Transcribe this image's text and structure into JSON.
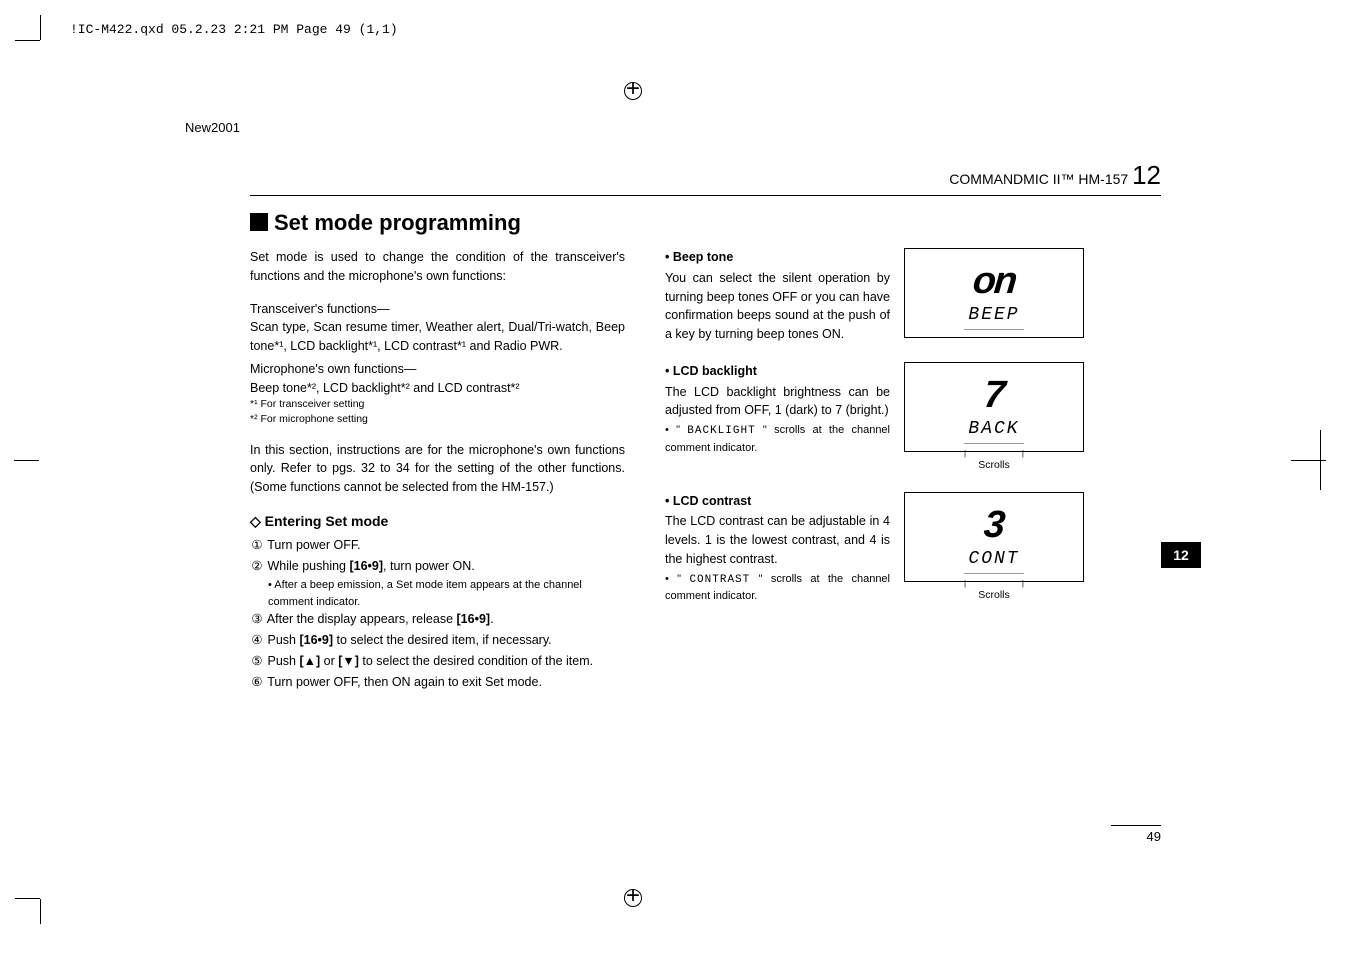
{
  "meta": {
    "header_line": "!IC-M422.qxd  05.2.23 2:21 PM  Page 49 (1,1)",
    "new_label": "New2001"
  },
  "page_header": {
    "product": "COMMANDMIC II™ HM-157",
    "chapter": "12"
  },
  "section": {
    "title": "Set mode programming"
  },
  "left": {
    "intro": "Set mode is used to change the condition of the transceiver's functions and the microphone's own functions:",
    "trans_label": "Transceiver's functions—",
    "trans_text": "Scan type, Scan resume timer, Weather alert, Dual/Tri-watch, Beep tone*¹, LCD backlight*¹, LCD contrast*¹ and Radio PWR.",
    "mic_label": "Microphone's own functions—",
    "mic_text": "Beep tone*², LCD backlight*² and LCD contrast*²",
    "fn1": "*¹ For transceiver setting",
    "fn2": "*² For microphone setting",
    "note": "In this section, instructions are for the microphone's own functions only. Refer to pgs. 32 to 34 for the setting of the other functions. (Some functions cannot be selected from the HM-157.)",
    "entering_title": "Entering Set mode",
    "steps": {
      "s1": "Turn power OFF.",
      "s2_a": "While pushing ",
      "s2_key": "[16•9]",
      "s2_b": ", turn power ON.",
      "s2_sub": "• After a beep emission, a Set mode item appears at the channel comment indicator.",
      "s3_a": "After the display appears, release ",
      "s3_key": "[16•9]",
      "s3_b": ".",
      "s4_a": "Push ",
      "s4_key": "[16•9]",
      "s4_b": " to select the desired item, if necessary.",
      "s5_a": "Push ",
      "s5_up": "[▲]",
      "s5_mid": " or ",
      "s5_down": "[▼]",
      "s5_b": " to select the desired condition of the item.",
      "s6": "Turn power OFF, then ON again to exit Set mode."
    }
  },
  "right": {
    "beep": {
      "title": "• Beep tone",
      "text": "You can select the silent operation by turning beep tones OFF or you can have confirmation beeps sound at the push of a key by turning beep tones ON.",
      "lcd_big": "on",
      "lcd_small": "BEEP"
    },
    "backlight": {
      "title": "• LCD backlight",
      "text": "The LCD backlight brightness can be adjusted from OFF, 1 (dark) to 7 (bright.)",
      "bullet_a": "• \" ",
      "bullet_code": "BACKLIGHT",
      "bullet_b": " \" scrolls at the channel comment indicator.",
      "lcd_big": "7",
      "lcd_small": "BACK",
      "scrolls": "Scrolls"
    },
    "contrast": {
      "title": "• LCD contrast",
      "text": "The LCD contrast can be adjustable in 4 levels. 1 is the lowest contrast, and 4 is the highest contrast.",
      "bullet_a": "• \" ",
      "bullet_code": "CONTRAST",
      "bullet_b": " \" scrolls at the channel comment indicator.",
      "lcd_big": "3",
      "lcd_small": "CONT",
      "scrolls": "Scrolls"
    }
  },
  "tab": "12",
  "page_number": "49"
}
